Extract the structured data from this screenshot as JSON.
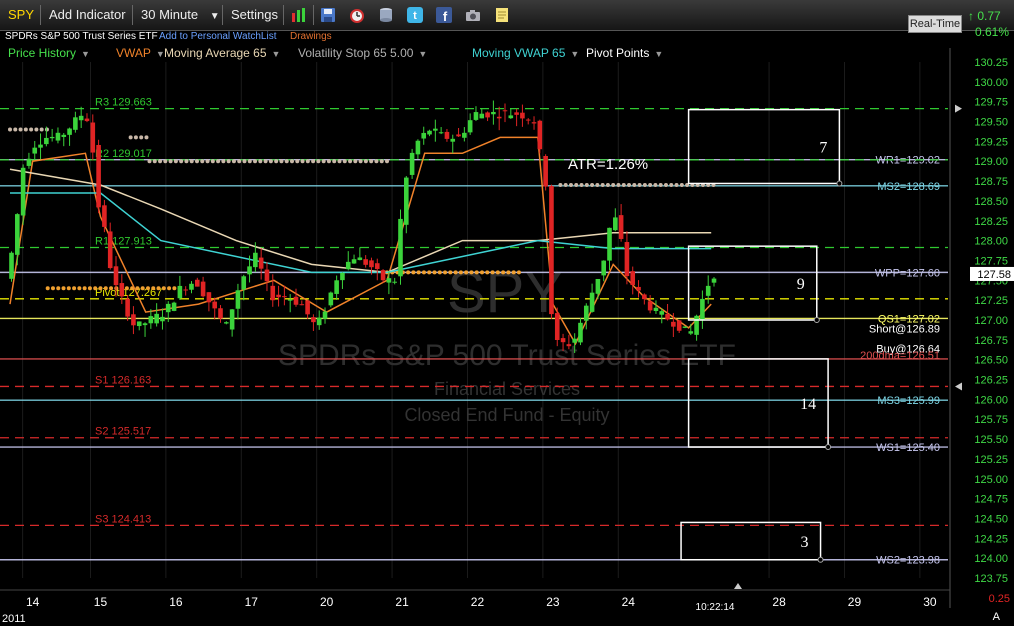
{
  "toolbar": {
    "symbol": "SPY",
    "add_indicator": "Add Indicator",
    "interval": "30 Minute",
    "settings": "Settings",
    "realtime": "Real-Time",
    "change": "0.77",
    "change_pct": "0.61%",
    "colors": {
      "up": "#46e04c"
    }
  },
  "subbar": {
    "title": "SPDRs S&P 500 Trust Series ETF",
    "watchlist": "Add to Personal WatchList",
    "drawings": "Drawings"
  },
  "studies": [
    {
      "label": "Price History",
      "color": "#46e04c"
    },
    {
      "label": "VWAP",
      "color": "#f0822a"
    },
    {
      "label": "Moving Average 65",
      "color": "#e9d7b4"
    },
    {
      "label": "Volatility Stop 65 5.00",
      "color": "#b0b0b0"
    },
    {
      "label": "Moving VWAP 65",
      "color": "#3fd3d3"
    },
    {
      "label": "Pivot Points",
      "color": "#ffffff"
    }
  ],
  "watermark": {
    "symbol": "SPY",
    "name": "SPDRs S&P 500 Trust Series ETF",
    "sector": "Financial Services",
    "type": "Closed End Fund - Equity"
  },
  "chart_data": {
    "type": "candlestick",
    "y_axis": {
      "min": 123.75,
      "max": 130.25,
      "step": 0.25,
      "ticks": [
        "130.25",
        "130.00",
        "129.75",
        "129.50",
        "129.25",
        "129.00",
        "128.75",
        "128.50",
        "128.25",
        "128.00",
        "127.75",
        "127.50",
        "127.25",
        "127.00",
        "126.75",
        "126.50",
        "126.25",
        "126.00",
        "125.75",
        "125.50",
        "125.25",
        "125.00",
        "124.75",
        "124.50",
        "124.25",
        "124.00",
        "123.75"
      ],
      "last_price": "127.58",
      "lower_pane_ticks": [
        "0.25",
        "A"
      ]
    },
    "x_axis": {
      "ticks": [
        {
          "label": "14",
          "x": 0.3
        },
        {
          "label": "15",
          "x": 1.2
        },
        {
          "label": "16",
          "x": 2.2
        },
        {
          "label": "17",
          "x": 3.2
        },
        {
          "label": "20",
          "x": 4.2
        },
        {
          "label": "21",
          "x": 5.2
        },
        {
          "label": "22",
          "x": 6.2
        },
        {
          "label": "23",
          "x": 7.2
        },
        {
          "label": "24",
          "x": 8.2
        },
        {
          "label": "28",
          "x": 10.2
        },
        {
          "label": "29",
          "x": 11.2
        },
        {
          "label": "30",
          "x": 12.2
        }
      ],
      "sub_label": "2011",
      "cursor_time": "10:22:14",
      "cursor_x": 9.35
    },
    "price_path": [
      [
        0.0,
        127.6
      ],
      [
        0.1,
        128.0
      ],
      [
        0.2,
        128.9
      ],
      [
        0.35,
        129.2
      ],
      [
        0.5,
        129.3
      ],
      [
        0.7,
        129.3
      ],
      [
        0.9,
        129.5
      ],
      [
        1.0,
        129.6
      ],
      [
        1.1,
        129.5
      ],
      [
        1.2,
        128.5
      ],
      [
        1.3,
        128.1
      ],
      [
        1.4,
        127.5
      ],
      [
        1.55,
        127.2
      ],
      [
        1.7,
        126.9
      ],
      [
        1.9,
        127.0
      ],
      [
        2.1,
        127.1
      ],
      [
        2.3,
        127.4
      ],
      [
        2.5,
        127.5
      ],
      [
        2.7,
        127.2
      ],
      [
        2.9,
        126.9
      ],
      [
        3.1,
        127.5
      ],
      [
        3.3,
        127.8
      ],
      [
        3.5,
        127.3
      ],
      [
        3.7,
        127.3
      ],
      [
        3.9,
        127.2
      ],
      [
        4.1,
        126.9
      ],
      [
        4.2,
        127.1
      ],
      [
        4.4,
        127.6
      ],
      [
        4.6,
        127.8
      ],
      [
        4.8,
        127.7
      ],
      [
        5.0,
        127.5
      ],
      [
        5.15,
        127.5
      ],
      [
        5.25,
        128.6
      ],
      [
        5.4,
        129.2
      ],
      [
        5.6,
        129.4
      ],
      [
        5.8,
        129.3
      ],
      [
        6.0,
        129.3
      ],
      [
        6.2,
        129.6
      ],
      [
        6.4,
        129.6
      ],
      [
        6.6,
        129.6
      ],
      [
        6.8,
        129.6
      ],
      [
        7.0,
        129.5
      ],
      [
        7.1,
        128.9
      ],
      [
        7.15,
        128.7
      ],
      [
        7.2,
        127.2
      ],
      [
        7.3,
        126.7
      ],
      [
        7.5,
        126.7
      ],
      [
        7.7,
        127.2
      ],
      [
        7.9,
        127.7
      ],
      [
        8.0,
        128.2
      ],
      [
        8.1,
        128.3
      ],
      [
        8.2,
        127.6
      ],
      [
        8.4,
        127.3
      ],
      [
        8.6,
        127.1
      ],
      [
        8.8,
        127.0
      ],
      [
        8.95,
        126.9
      ],
      [
        9.05,
        126.8
      ],
      [
        9.2,
        127.2
      ],
      [
        9.35,
        127.58
      ]
    ],
    "series": [
      {
        "name": "VWAP",
        "color": "#f0822a",
        "points": [
          [
            0.0,
            127.2
          ],
          [
            0.3,
            129.0
          ],
          [
            1.0,
            129.1
          ],
          [
            1.2,
            128.3
          ],
          [
            1.8,
            127.1
          ],
          [
            2.5,
            127.2
          ],
          [
            3.5,
            127.5
          ],
          [
            4.2,
            127.1
          ],
          [
            5.0,
            127.5
          ],
          [
            5.5,
            129.1
          ],
          [
            6.0,
            129.1
          ],
          [
            6.5,
            129.3
          ],
          [
            7.0,
            129.3
          ],
          [
            7.2,
            127.2
          ],
          [
            7.5,
            126.7
          ],
          [
            8.0,
            127.7
          ],
          [
            8.4,
            127.3
          ],
          [
            9.0,
            126.9
          ],
          [
            9.3,
            127.2
          ]
        ]
      },
      {
        "name": "Moving Average 65",
        "color": "#e9d7b4",
        "points": [
          [
            0.0,
            128.9
          ],
          [
            1.2,
            128.7
          ],
          [
            2.0,
            128.4
          ],
          [
            3.0,
            128.0
          ],
          [
            4.0,
            127.7
          ],
          [
            5.0,
            127.6
          ],
          [
            6.0,
            128.0
          ],
          [
            7.0,
            128.0
          ],
          [
            8.0,
            128.1
          ],
          [
            8.5,
            128.1
          ],
          [
            9.3,
            128.1
          ]
        ]
      },
      {
        "name": "Moving VWAP 65",
        "color": "#3fd3d3",
        "points": [
          [
            0.0,
            128.6
          ],
          [
            1.2,
            128.6
          ],
          [
            2.0,
            128.0
          ],
          [
            3.0,
            127.8
          ],
          [
            4.0,
            127.6
          ],
          [
            5.0,
            127.6
          ],
          [
            6.0,
            127.8
          ],
          [
            7.0,
            128.0
          ],
          [
            8.0,
            127.9
          ],
          [
            9.3,
            127.9
          ]
        ]
      }
    ],
    "volatility_stop": [
      {
        "start": 0.0,
        "end": 0.5,
        "value": 129.4
      },
      {
        "start": 1.6,
        "end": 1.85,
        "value": 129.3
      },
      {
        "start": 1.85,
        "end": 5.0,
        "value": 129.0
      },
      {
        "start": 0.5,
        "end": 2.3,
        "value": 127.4
      },
      {
        "start": 5.0,
        "end": 6.8,
        "value": 127.6
      },
      {
        "start": 7.3,
        "end": 9.35,
        "value": 128.7
      }
    ],
    "pivot_lines": [
      {
        "label": "R3 129.663",
        "value": 129.663,
        "color": "#2fc92f"
      },
      {
        "label": "R2 129.017",
        "value": 129.017,
        "color": "#2fc92f"
      },
      {
        "label": "R1 127.913",
        "value": 127.913,
        "color": "#2fc92f"
      },
      {
        "label": "Pivot 127.267",
        "value": 127.267,
        "color": "#e6e600"
      },
      {
        "label": "S1 126.163",
        "value": 126.163,
        "color": "#d62a2a"
      },
      {
        "label": "S2 125.517",
        "value": 125.517,
        "color": "#d62a2a"
      },
      {
        "label": "S3 124.413",
        "value": 124.413,
        "color": "#d62a2a"
      }
    ],
    "level_lines": [
      {
        "label": "WR1=129.02",
        "value": 129.02,
        "color": "#c8c8f0"
      },
      {
        "label": "MS2=128.69",
        "value": 128.69,
        "color": "#7fd8e8"
      },
      {
        "label": "WPP=127.60",
        "value": 127.6,
        "color": "#c8c8f0"
      },
      {
        "label": "QS1=127.02",
        "value": 127.02,
        "color": "#ffff66"
      },
      {
        "label": "Short@126.89",
        "value": 126.89,
        "color": "#ffffff"
      },
      {
        "label": "Buy@126.64",
        "value": 126.64,
        "color": "#ffffff"
      },
      {
        "label": "200dma=126.51",
        "value": 126.51,
        "color": "#e05050"
      },
      {
        "label": "MS3=125.99",
        "value": 125.99,
        "color": "#7fd8e8"
      },
      {
        "label": "WS1=125.40",
        "value": 125.4,
        "color": "#c8c8f0"
      },
      {
        "label": "WS2=123.98",
        "value": 123.98,
        "color": "#c8c8f0"
      }
    ],
    "boxes": [
      {
        "label": "7",
        "x0": 9.0,
        "x1": 11.0,
        "top": 129.65,
        "bottom": 128.72
      },
      {
        "label": "9",
        "x0": 9.0,
        "x1": 10.7,
        "top": 127.93,
        "bottom": 127.0
      },
      {
        "label": "14",
        "x0": 9.0,
        "x1": 10.85,
        "top": 126.51,
        "bottom": 125.4
      },
      {
        "label": "3",
        "x0": 8.9,
        "x1": 10.75,
        "top": 124.45,
        "bottom": 123.98
      }
    ],
    "annotations": [
      {
        "text": "ATR=1.26%",
        "x": 7.4,
        "y": 128.9
      }
    ]
  }
}
